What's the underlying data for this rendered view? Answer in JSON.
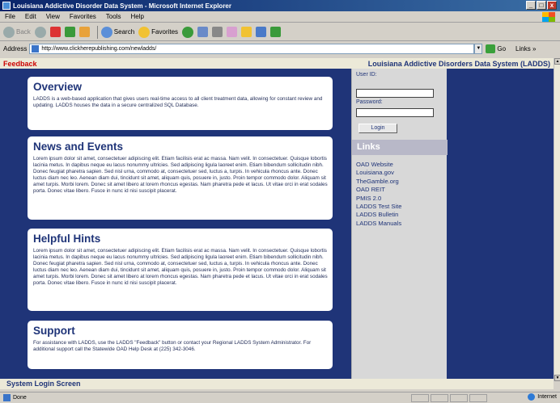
{
  "window": {
    "title": "Louisiana Addictive Disorder Data System - Microsoft Internet Explorer",
    "controls": [
      "_",
      "□",
      "x"
    ]
  },
  "menu": [
    "File",
    "Edit",
    "View",
    "Favorites",
    "Tools",
    "Help"
  ],
  "toolbar": {
    "back": "Back",
    "search": "Search",
    "favorites": "Favorites"
  },
  "address": {
    "label": "Address",
    "url": "http://www.clickherepublishing.com/newladds/",
    "go": "Go",
    "links": "Links"
  },
  "page": {
    "feedback": "Feedback",
    "site_title": "Louisiana Addictive Disorders Data System (LADDS)",
    "footer": "System Login Screen",
    "cards": [
      {
        "title": "Overview",
        "body": "LADDS is a web-based application that gives users real-time access to all client treatment data, allowing for constant review and updating. LADDS houses the data in a secure centralized SQL Database."
      },
      {
        "title": "News and Events",
        "body": "Lorem ipsum dolor sit amet, consectetuer adipiscing elit. Etiam facilisis erat ac massa. Nam velit. In consectetuer. Quisque lobortis lacinia metus. In dapibus neque eu lacus nonummy ultricies. Sed adipiscing ligula laoreet enim. Etiam bibendum sollicitudin nibh. Donec feugiat pharetra sapien. Sed nisl urna, commodo at, consectetuer sed, luctus a, turpis. In vehicula rhoncus ante. Donec luctus diam nec leo. Aenean diam dui, tincidunt sit amet, aliquam quis, posuere in, justo. Proin tempor commodo dolor. Aliquam sit amet turpis. Morbi lorem. Donec sit amet libero at lorem rhoncus egestas. Nam pharetra pede et lacus. Ut vitae orci in erat sodales porta. Donec vitae libero. Fusce in nunc id nisi suscipit placerat."
      },
      {
        "title": "Helpful Hints",
        "body": "Lorem ipsum dolor sit amet, consectetuer adipiscing elit. Etiam facilisis erat ac massa. Nam velit. In consectetuer. Quisque lobortis lacinia metus. In dapibus neque eu lacus nonummy ultricies. Sed adipiscing ligula laoreet enim. Etiam bibendum sollicitudin nibh. Donec feugiat pharetra sapien. Sed nisl urna, commodo at, consectetuer sed, luctus a, turpis. In vehicula rhoncus ante. Donec luctus diam nec leo. Aenean diam dui, tincidunt sit amet, aliquam quis, posuere in, justo. Proin tempor commodo dolor. Aliquam sit amet turpis. Morbi lorem. Donec sit amet libero at lorem rhoncus egestas. Nam pharetra pede et lacus. Ut vitae orci in erat sodales porta. Donec vitae libero. Fusce in nunc id nisi suscipit placerat."
      },
      {
        "title": "Support",
        "body": "For assistance with LADDS, use the LADDS \"Feedback\" button or contact your Regional LADDS System Administrator. For additional support call the Statewide OAD Help Desk at (225) 342-3046."
      }
    ],
    "login": {
      "user_label": "User ID:",
      "password_label": "Password:",
      "button": "Login"
    },
    "links_heading": "Links",
    "links": [
      "OAD Website",
      "Louisiana.gov",
      "TheGamble.org",
      "OAD REIT",
      "PMIS 2.0",
      "LADDS Test Site",
      "LADDS Bulletin",
      "LADDS Manuals"
    ]
  },
  "status": {
    "left": "Done",
    "zone": "Internet"
  },
  "colors": {
    "page_bg": "#1f3478",
    "feedback": "#cc0000",
    "chrome": "#d4d0c8"
  }
}
